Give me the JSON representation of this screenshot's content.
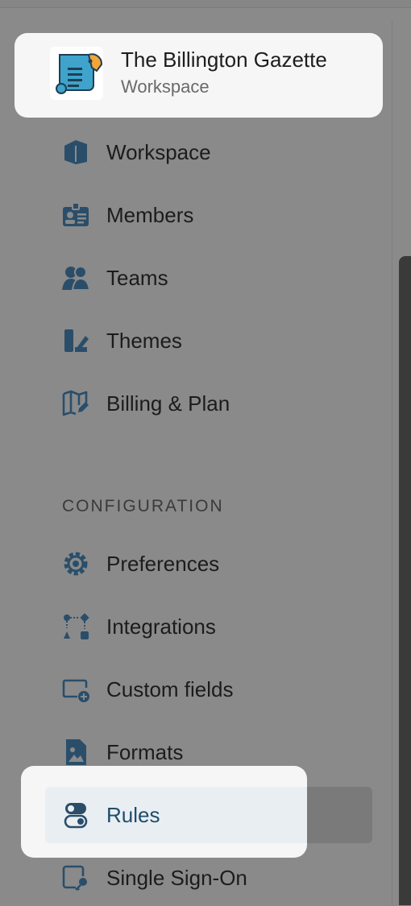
{
  "workspace": {
    "name": "The Billington Gazette",
    "subtitle": "Workspace"
  },
  "nav": [
    {
      "label": "Workspace",
      "icon": "building-icon"
    },
    {
      "label": "Members",
      "icon": "id-card-icon"
    },
    {
      "label": "Teams",
      "icon": "people-icon"
    },
    {
      "label": "Themes",
      "icon": "palette-icon"
    },
    {
      "label": "Billing & Plan",
      "icon": "map-pen-icon"
    }
  ],
  "section": {
    "label": "CONFIGURATION"
  },
  "config": [
    {
      "label": "Preferences",
      "icon": "gear-icon"
    },
    {
      "label": "Integrations",
      "icon": "integrations-icon"
    },
    {
      "label": "Custom fields",
      "icon": "custom-fields-icon"
    },
    {
      "label": "Formats",
      "icon": "image-file-icon"
    },
    {
      "label": "Rules",
      "icon": "toggle-icon",
      "active": true
    },
    {
      "label": "Single Sign-On",
      "icon": "sso-icon"
    }
  ],
  "colors": {
    "icon": "#2a4e6a",
    "active_bg": "#e9eef2",
    "card_bg": "#f6f6f6"
  }
}
